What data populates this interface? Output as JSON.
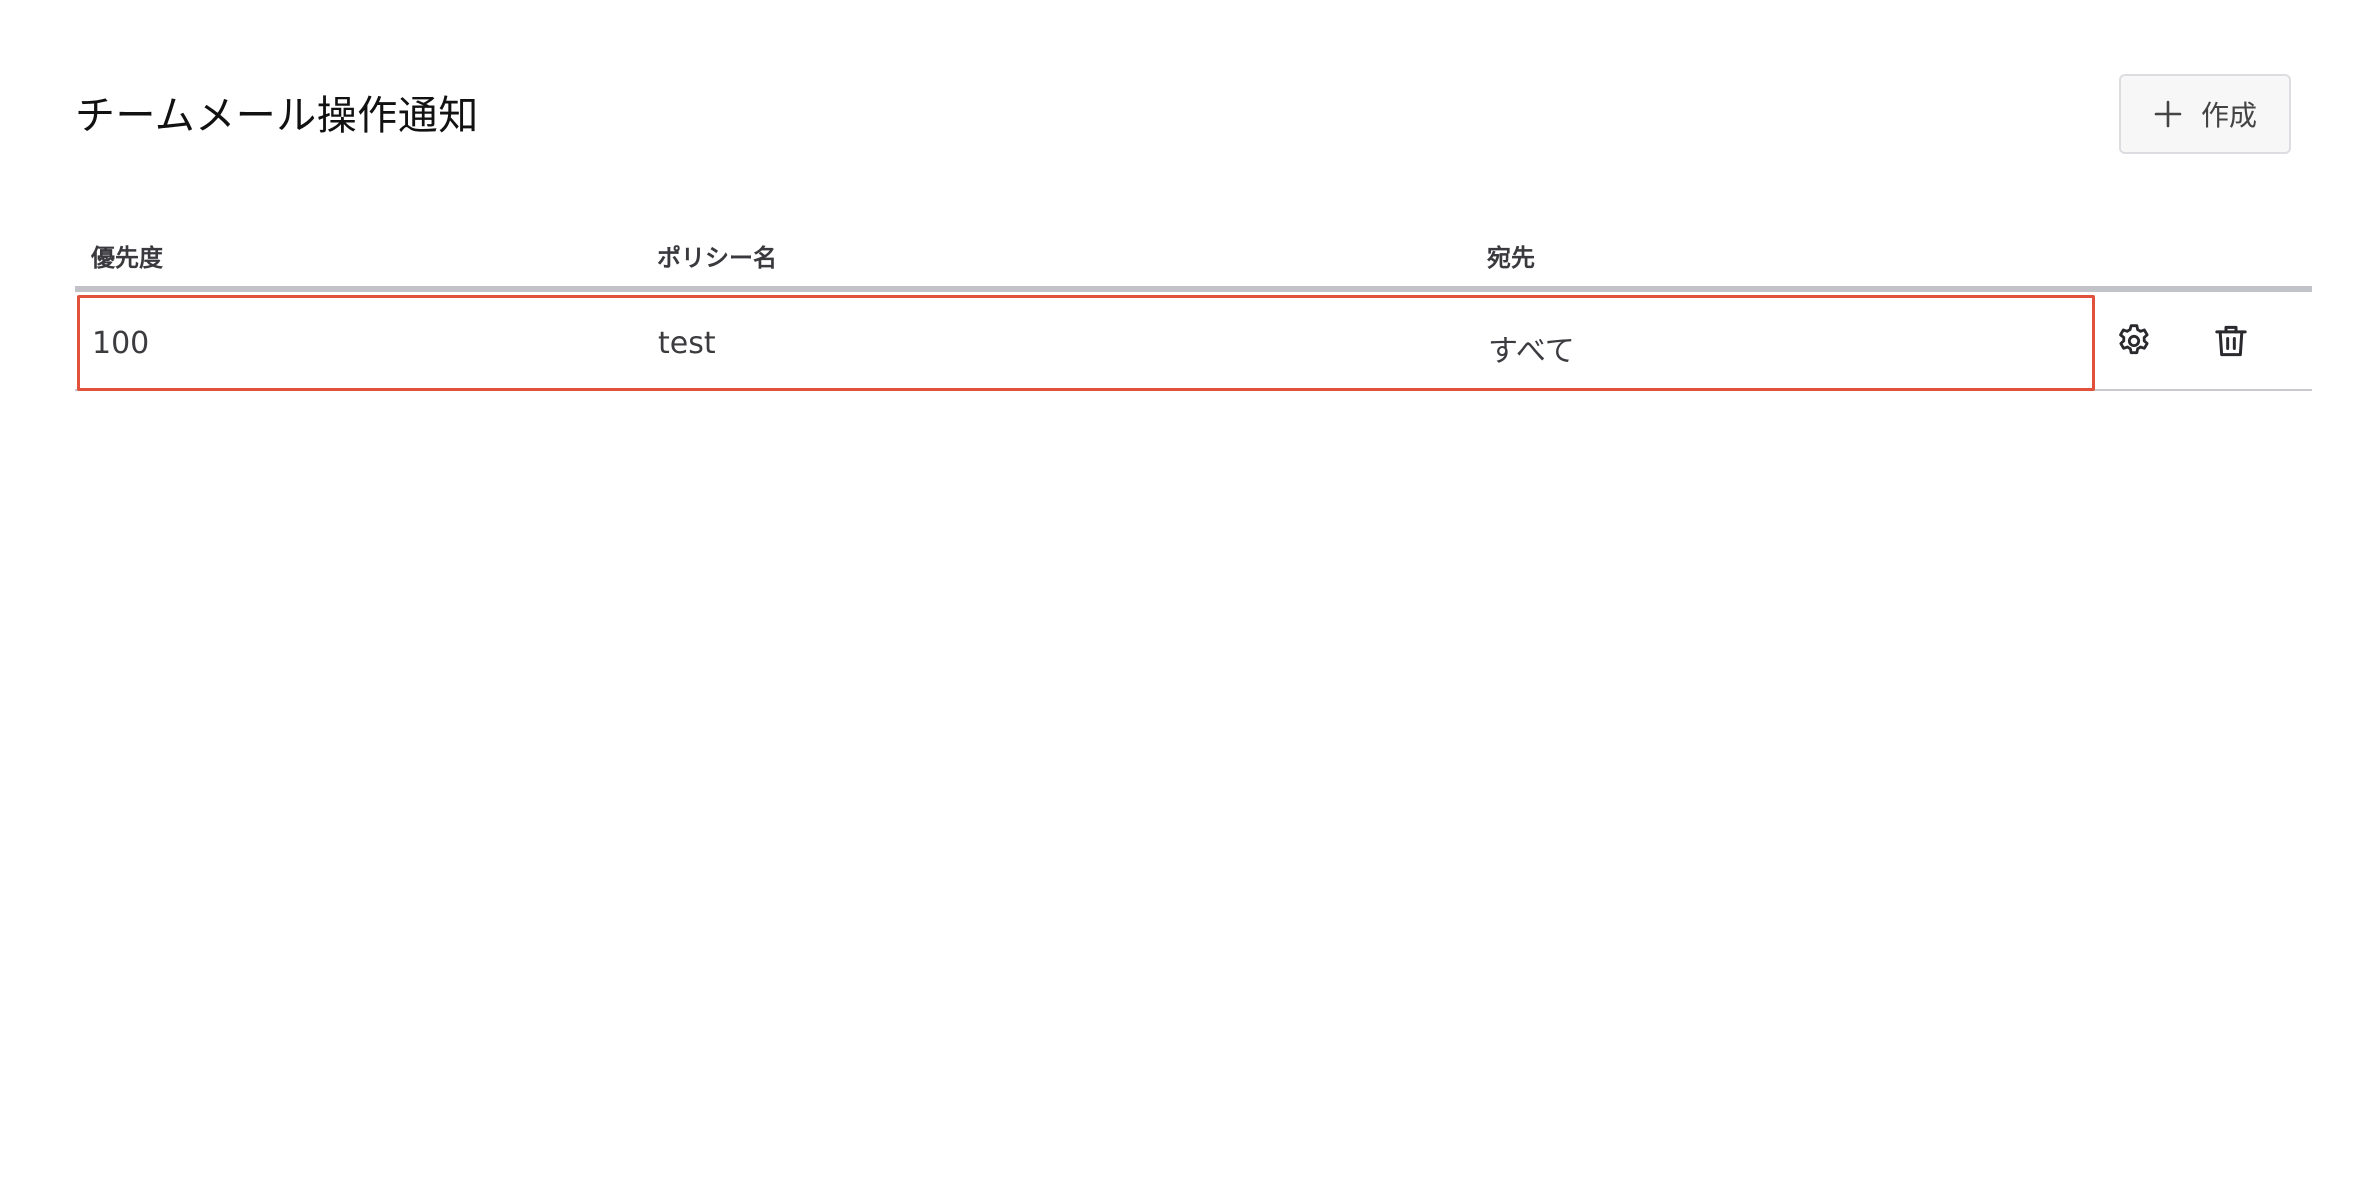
{
  "page": {
    "title": "チームメール操作通知"
  },
  "toolbar": {
    "create_label": "作成",
    "create_icon": "plus-icon"
  },
  "table": {
    "columns": [
      "優先度",
      "ポリシー名",
      "宛先"
    ],
    "rows": [
      {
        "priority": "100",
        "policy_name": "test",
        "destination": "すべて",
        "actions": [
          "gear-icon",
          "trash-icon"
        ]
      }
    ]
  },
  "colors": {
    "selected_row_border": "#e0523c",
    "header_rule": "#c2c3c9",
    "button_bg": "#f7f7f8",
    "button_border": "#dcdde0"
  }
}
